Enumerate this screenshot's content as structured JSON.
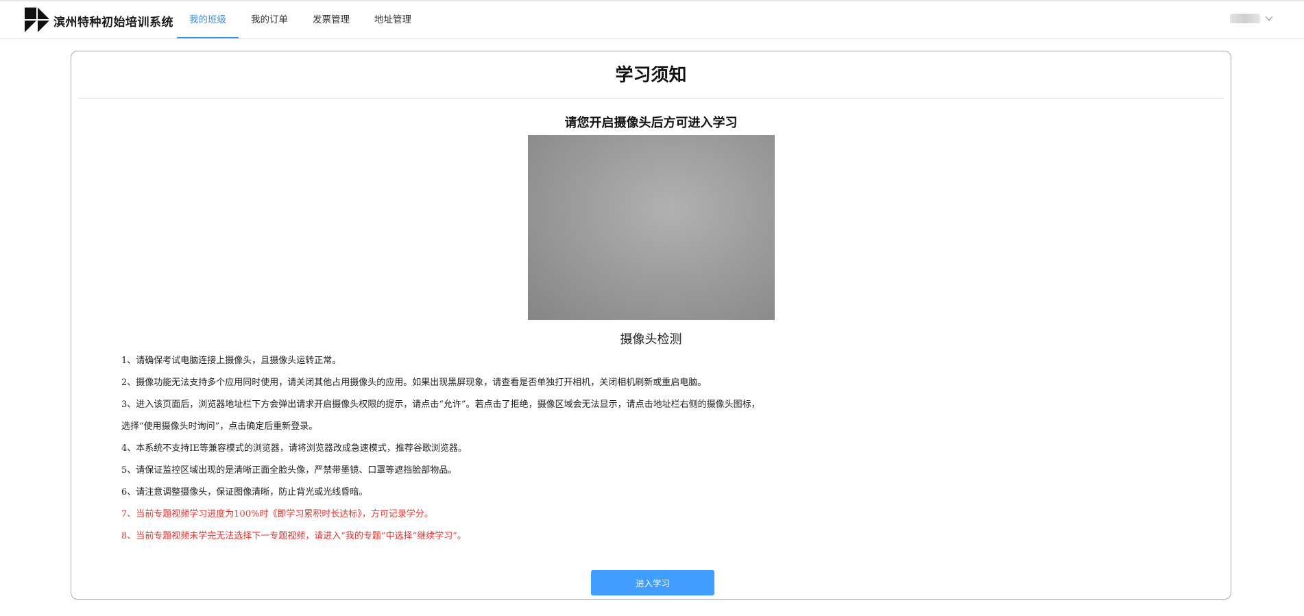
{
  "app": {
    "title": "滨州特种初始培训系统"
  },
  "nav": {
    "items": [
      {
        "label": "我的班级",
        "active": true
      },
      {
        "label": "我的订单",
        "active": false
      },
      {
        "label": "发票管理",
        "active": false
      },
      {
        "label": "地址管理",
        "active": false
      }
    ]
  },
  "colors": {
    "accent": "#409eff",
    "nav_active": "#3a8ee6",
    "warning": "#e5322d"
  },
  "icons": {
    "logo": "brand-logo-icon",
    "user_menu": "chevron-down-icon"
  },
  "page": {
    "title": "学习须知",
    "camera_heading": "请您开启摄像头后方可进入学习",
    "camera_label": "摄像头检测",
    "notes": [
      {
        "text": "1、请确保考试电脑连接上摄像头，且摄像头运转正常。",
        "highlight": false
      },
      {
        "text": "2、摄像功能无法支持多个应用同时使用，请关闭其他占用摄像头的应用。如果出现黑屏现象，请查看是否单独打开相机，关闭相机刷新或重启电脑。",
        "highlight": false
      },
      {
        "text": "3、进入该页面后，浏览器地址栏下方会弹出请求开启摄像头权限的提示，请点击“允许”。若点击了拒绝，摄像区域会无法显示，请点击地址栏右侧的摄像头图标，",
        "highlight": false
      },
      {
        "text": "选择“使用摄像头时询问”，点击确定后重新登录。",
        "highlight": false
      },
      {
        "text": "4、本系统不支持IE等兼容模式的浏览器，请将浏览器改成急速模式，推荐谷歌浏览器。",
        "highlight": false
      },
      {
        "text": "5、请保证监控区域出现的是清晰正面全脸头像，严禁带墨镜、口罩等遮挡脸部物品。",
        "highlight": false
      },
      {
        "text": "6、请注意调整摄像头，保证图像清晰，防止背光或光线昏暗。",
        "highlight": false
      },
      {
        "text": "7、当前专题视频学习进度为100%时《即学习累积时长达标》，方可记录学分。",
        "highlight": true
      },
      {
        "text": "8、当前专题视频未学完无法选择下一专题视频，请进入“我的专题”中选择“继续学习”。",
        "highlight": true
      }
    ],
    "enter_button": "进入学习"
  }
}
